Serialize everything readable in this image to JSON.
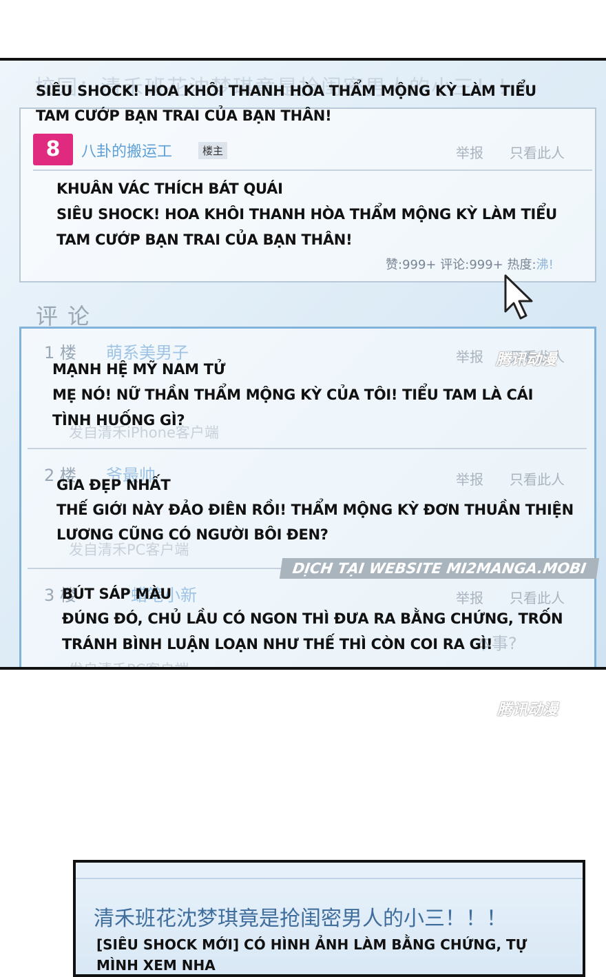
{
  "panel1": {
    "ghost_title": "校园：清禾班花沈梦琪竟是抢闺密男人的小三！！！",
    "caption_title": [
      "SIÊU SHOCK! HOA KHÔI THANH HÒA THẨM MỘNG KỲ LÀM TIỂU",
      "TAM CƯỚP BẠN TRAI CỦA BẠN THÂN!"
    ],
    "post": {
      "poster_name": "八卦的搬运工",
      "poster_badge": "楼主",
      "report": "举报",
      "only_this": "只看此人",
      "caption_lines": [
        "KHUÂN VÁC THÍCH BÁT QUÁI",
        "SIÊU SHOCK! HOA KHÔI THANH HÒA THẨM MỘNG KỲ LÀM TIỂU",
        "TAM CƯỚP BẠN TRAI CỦA BẠN THÂN!"
      ],
      "likes_label": "赞:999+",
      "comments_label": "评论:999+",
      "hot_label": "热度:",
      "hot_value": "沸!"
    },
    "comments_header": "评论",
    "comments": [
      {
        "floor": "1 楼",
        "name": "萌系美男子",
        "report": "举报",
        "only_this": "只看此人",
        "client": "发自清禾iPhone客户端",
        "caption_lines": [
          "MẠNH HỆ MỸ NAM TỬ",
          "MẸ NÓ! NỮ THẦN THẨM MỘNG KỲ CỦA TÔI! TIỂU TAM LÀ CÁI",
          "TÌNH HUỐNG GÌ?"
        ]
      },
      {
        "floor": "2 楼",
        "name": "爷最帅",
        "report": "举报",
        "only_this": "只看此人",
        "client": "发自清禾PC客户端",
        "caption_lines": [
          "GIA ĐẸP NHẤT",
          "THẾ GIỚI NÀY ĐẢO ĐIÊN RỒI! THẨM MỘNG KỲ ĐƠN THUẦN THIỆN",
          "LƯƠNG CŨNG CÓ NGƯỜI BÔI ĐEN?"
        ]
      },
      {
        "floor": "3 楼",
        "name": "蜡笔小新",
        "report": "举报",
        "only_this": "只看此人",
        "client": "发自清禾PC客户端",
        "caption_lines": [
          "BÚT SÁP MÀU",
          "ĐÚNG ĐÓ, CHỦ LẦU CÓ NGON THÌ ĐƯA RA BẰNG CHỨNG, TRỐN",
          "TRÁNH BÌNH LUẬN LOẠN NHƯ THẾ THÌ CÒN COI RA GÌ!"
        ],
        "faded_tail": "本事?"
      }
    ],
    "watermark": "腾讯动漫",
    "site_banner": "DỊCH TẠI WEBSITE MI2MANGA.MOBI"
  },
  "bottom": {
    "watermark": "腾讯动漫",
    "panel2_title": "清禾班花沈梦琪竟是抢闺密男人的小三！！！",
    "panel2_caption": [
      "[SIÊU SHOCK MỚI] CÓ HÌNH ẢNH LÀM BẰNG CHỨNG, TỰ",
      "MÌNH XEM NHA"
    ]
  }
}
